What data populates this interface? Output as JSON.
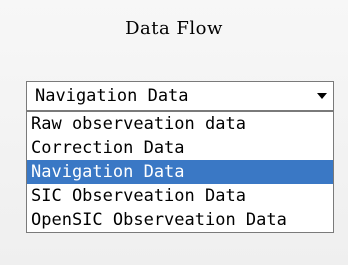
{
  "panel": {
    "title": "Data Flow"
  },
  "select": {
    "selected_value": "Navigation Data",
    "options": [
      {
        "label": "Raw observeation data",
        "selected": false
      },
      {
        "label": "Correction Data",
        "selected": false
      },
      {
        "label": "Navigation Data",
        "selected": true
      },
      {
        "label": "SIC Observeation Data",
        "selected": false
      },
      {
        "label": "OpenSIC Observeation Data",
        "selected": false
      }
    ]
  },
  "colors": {
    "highlight": "#3a78c5",
    "border": "#7a7a7a"
  }
}
